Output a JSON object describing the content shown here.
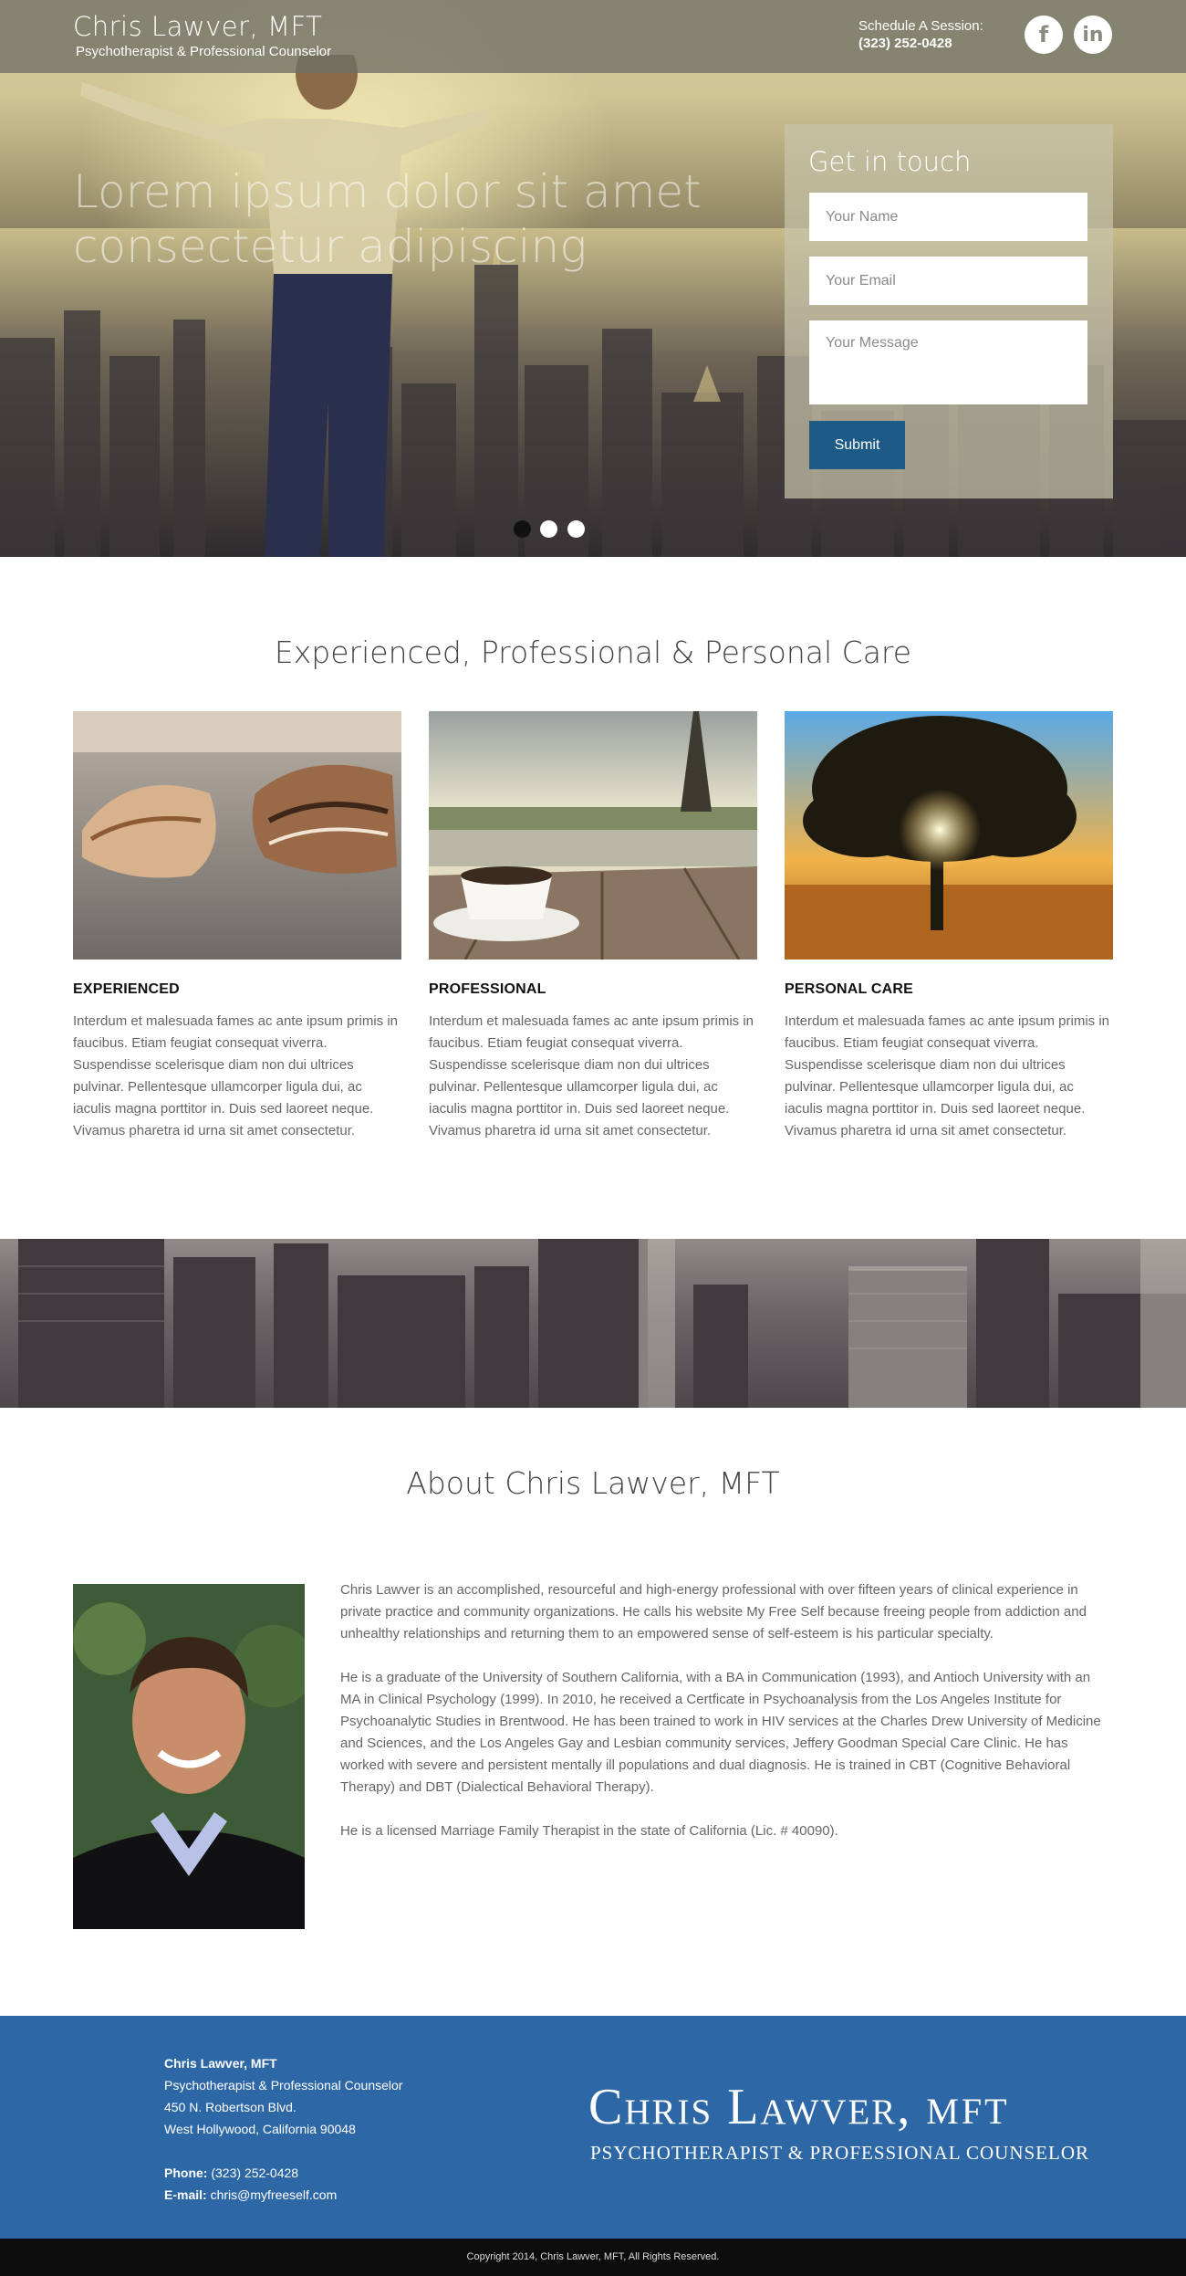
{
  "header": {
    "name": "Chris Lawver, MFT",
    "tagline": "Psychotherapist & Professional Counselor",
    "schedule_label": "Schedule A Session:",
    "schedule_phone": "(323) 252-0428",
    "social": [
      {
        "icon": "facebook-icon",
        "glyph": "f"
      },
      {
        "icon": "linkedin-icon",
        "glyph": "in"
      }
    ]
  },
  "hero": {
    "headline": "Lorem ipsum dolor sit amet consectetur adipiscing",
    "slides": 3,
    "active_slide": 1
  },
  "contact_form": {
    "title": "Get in touch",
    "name_placeholder": "Your Name",
    "email_placeholder": "Your Email",
    "message_placeholder": "Your Message",
    "submit_label": "Submit"
  },
  "features": {
    "title": "Experienced, Professional & Personal Care",
    "items": [
      {
        "heading": "EXPERIENCED",
        "image": "seashells-on-beach",
        "text": "Interdum et malesuada fames ac ante ipsum primis in faucibus. Etiam feugiat consequat viverra. Suspendisse scelerisque diam non dui ultrices pulvinar. Pellentesque ullamcorper ligula dui, ac iaculis magna porttitor in. Duis sed laoreet neque. Vivamus pharetra id urna sit amet consectetur."
      },
      {
        "heading": "PROFESSIONAL",
        "image": "coffee-cup-paris",
        "text": "Interdum et malesuada fames ac ante ipsum primis in faucibus. Etiam feugiat consequat viverra. Suspendisse scelerisque diam non dui ultrices pulvinar. Pellentesque ullamcorper ligula dui, ac iaculis magna porttitor in. Duis sed laoreet neque. Vivamus pharetra id urna sit amet consectetur."
      },
      {
        "heading": "PERSONAL CARE",
        "image": "tree-at-sunrise",
        "text": "Interdum et malesuada fames ac ante ipsum primis in faucibus. Etiam feugiat consequat viverra. Suspendisse scelerisque diam non dui ultrices pulvinar. Pellentesque ullamcorper ligula dui, ac iaculis magna porttitor in. Duis sed laoreet neque. Vivamus pharetra id urna sit amet consectetur."
      }
    ]
  },
  "about": {
    "title": "About Chris Lawver, MFT",
    "paragraphs": [
      "Chris Lawver is an accomplished, resourceful and high-energy professional with over fifteen years of clinical experience in private practice and community organizations. He calls his website My Free Self because freeing people from addiction and unhealthy relationships and returning them to an empowered sense of self-esteem is his particular specialty.",
      "He is a graduate of the University of Southern California, with a BA in Communication (1993), and Antioch University with an MA in Clinical Psychology (1999). In 2010, he received a Certficate in Psychoanalysis from the Los Angeles Institute for Psychoanalytic Studies in Brentwood. He has been trained to work in HIV services at the Charles Drew University of Medicine and Sciences, and the Los Angeles Gay and Lesbian community services, Jeffery Goodman Special Care Clinic. He has worked with severe and persistent mentally ill populations and dual diagnosis. He is trained in CBT (Cognitive Behavioral Therapy) and DBT (Dialectical Behavioral Therapy).",
      "He is a licensed Marriage Family Therapist in the state of California (Lic. # 40090)."
    ]
  },
  "footer": {
    "name": "Chris Lawver, MFT",
    "title": "Psychotherapist & Professional Counselor",
    "address1": "450 N. Robertson Blvd.",
    "address2": "West Hollywood, California 90048",
    "phone_label": "Phone:",
    "phone": "(323) 252-0428",
    "email_label": "E-mail:",
    "email": "chris@myfreeself.com",
    "logo_name": "Chris Lawver,",
    "logo_cred": "MFT",
    "logo_tagline": "Psychotherapist & Professional Counselor",
    "copyright": "Copyright 2014, Chris Lawver, MFT, All Rights Reserved."
  },
  "colors": {
    "accent_button": "#1e5a86",
    "footer_bg": "#2e67a6",
    "copyright_bg": "#0c0c0c"
  }
}
